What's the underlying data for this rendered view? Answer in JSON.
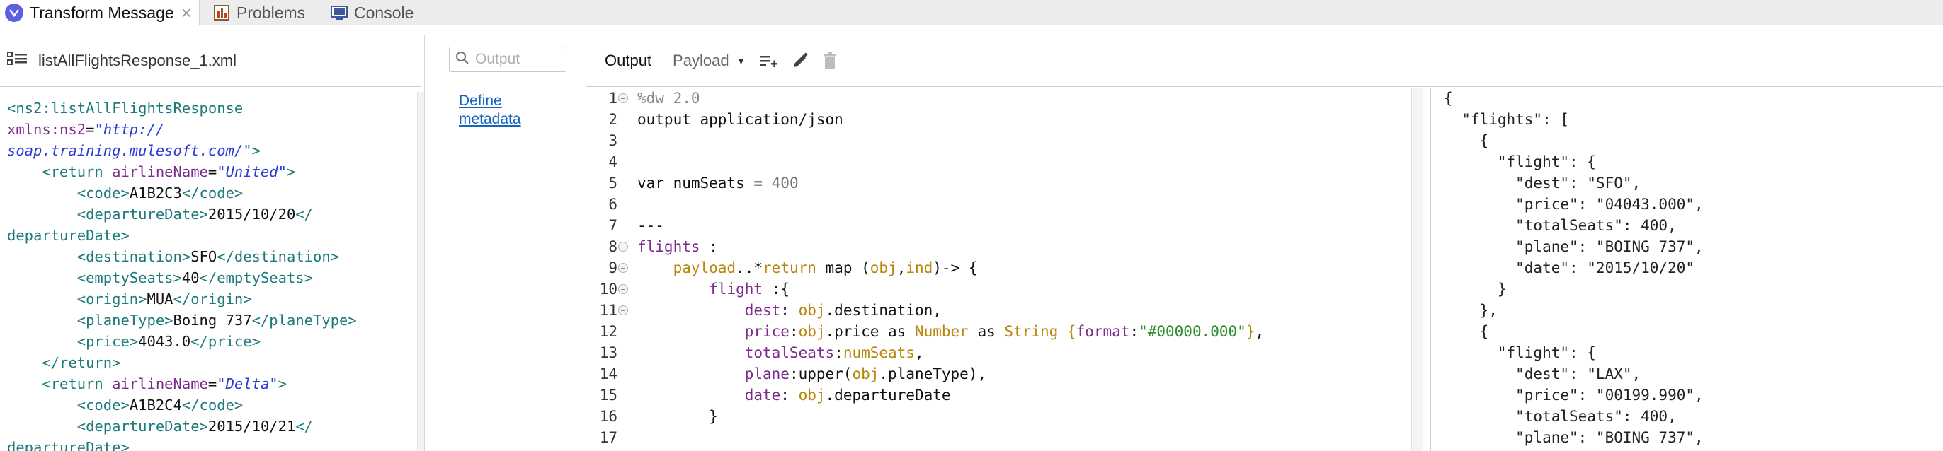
{
  "tabs": [
    {
      "label": "Transform Message",
      "icon": "transform-icon",
      "active": true
    },
    {
      "label": "Problems",
      "icon": "problems-icon",
      "active": false
    },
    {
      "label": "Console",
      "icon": "console-icon",
      "active": false
    }
  ],
  "input_panel": {
    "file_name": "listAllFlightsResponse_1.xml",
    "xml_lines": [
      [
        {
          "c": "t",
          "s": "<ns2:listAllFlightsResponse"
        }
      ],
      [
        {
          "c": "a",
          "s": "xmlns:ns2"
        },
        {
          "c": "tx",
          "s": "="
        },
        {
          "c": "v",
          "s": "\"http://"
        }
      ],
      [
        {
          "c": "v",
          "s": "soap.training.mulesoft.com/\""
        },
        {
          "c": "t",
          "s": ">"
        }
      ],
      [
        {
          "c": "tx",
          "s": "    "
        },
        {
          "c": "t",
          "s": "<return "
        },
        {
          "c": "a",
          "s": "airlineName"
        },
        {
          "c": "tx",
          "s": "="
        },
        {
          "c": "v",
          "s": "\"United\""
        },
        {
          "c": "t",
          "s": ">"
        }
      ],
      [
        {
          "c": "tx",
          "s": "        "
        },
        {
          "c": "t",
          "s": "<code>"
        },
        {
          "c": "tx",
          "s": "A1B2C3"
        },
        {
          "c": "t",
          "s": "</code>"
        }
      ],
      [
        {
          "c": "tx",
          "s": "        "
        },
        {
          "c": "t",
          "s": "<departureDate>"
        },
        {
          "c": "tx",
          "s": "2015/10/20"
        },
        {
          "c": "t",
          "s": "</"
        }
      ],
      [
        {
          "c": "t",
          "s": "departureDate>"
        }
      ],
      [
        {
          "c": "tx",
          "s": "        "
        },
        {
          "c": "t",
          "s": "<destination>"
        },
        {
          "c": "tx",
          "s": "SFO"
        },
        {
          "c": "t",
          "s": "</destination>"
        }
      ],
      [
        {
          "c": "tx",
          "s": "        "
        },
        {
          "c": "t",
          "s": "<emptySeats>"
        },
        {
          "c": "tx",
          "s": "40"
        },
        {
          "c": "t",
          "s": "</emptySeats>"
        }
      ],
      [
        {
          "c": "tx",
          "s": "        "
        },
        {
          "c": "t",
          "s": "<origin>"
        },
        {
          "c": "tx",
          "s": "MUA"
        },
        {
          "c": "t",
          "s": "</origin>"
        }
      ],
      [
        {
          "c": "tx",
          "s": "        "
        },
        {
          "c": "t",
          "s": "<planeType>"
        },
        {
          "c": "tx",
          "s": "Boing 737"
        },
        {
          "c": "t",
          "s": "</planeType>"
        }
      ],
      [
        {
          "c": "tx",
          "s": "        "
        },
        {
          "c": "t",
          "s": "<price>"
        },
        {
          "c": "tx",
          "s": "4043.0"
        },
        {
          "c": "t",
          "s": "</price>"
        }
      ],
      [
        {
          "c": "tx",
          "s": "    "
        },
        {
          "c": "t",
          "s": "</return>"
        }
      ],
      [
        {
          "c": "tx",
          "s": "    "
        },
        {
          "c": "t",
          "s": "<return "
        },
        {
          "c": "a",
          "s": "airlineName"
        },
        {
          "c": "tx",
          "s": "="
        },
        {
          "c": "v",
          "s": "\"Delta\""
        },
        {
          "c": "t",
          "s": ">"
        }
      ],
      [
        {
          "c": "tx",
          "s": "        "
        },
        {
          "c": "t",
          "s": "<code>"
        },
        {
          "c": "tx",
          "s": "A1B2C4"
        },
        {
          "c": "t",
          "s": "</code>"
        }
      ],
      [
        {
          "c": "tx",
          "s": "        "
        },
        {
          "c": "t",
          "s": "<departureDate>"
        },
        {
          "c": "tx",
          "s": "2015/10/21"
        },
        {
          "c": "t",
          "s": "</"
        }
      ],
      [
        {
          "c": "t",
          "s": "departureDate>"
        }
      ]
    ]
  },
  "metadata_panel": {
    "search_placeholder": "Output",
    "define_metadata_label": "Define metadata"
  },
  "editor": {
    "output_label": "Output",
    "target_select": "Payload",
    "icons": [
      "add-list-icon",
      "edit-icon",
      "delete-icon"
    ],
    "lines": [
      {
        "n": "1",
        "fold": true,
        "t": [
          {
            "c": "gr",
            "s": "%dw 2.0"
          }
        ]
      },
      {
        "n": "2",
        "fold": false,
        "t": [
          {
            "c": "op",
            "s": "output application/json"
          }
        ]
      },
      {
        "n": "3",
        "fold": false,
        "t": []
      },
      {
        "n": "4",
        "fold": false,
        "t": []
      },
      {
        "n": "5",
        "fold": false,
        "t": [
          {
            "c": "op",
            "s": "var numSeats = "
          },
          {
            "c": "num",
            "s": "400"
          }
        ]
      },
      {
        "n": "6",
        "fold": false,
        "t": []
      },
      {
        "n": "7",
        "fold": false,
        "t": [
          {
            "c": "op",
            "s": "---"
          }
        ]
      },
      {
        "n": "8",
        "fold": true,
        "t": [
          {
            "c": "kw",
            "s": "flights"
          },
          {
            "c": "op",
            "s": " :"
          }
        ]
      },
      {
        "n": "9",
        "fold": true,
        "t": [
          {
            "c": "op",
            "s": "    "
          },
          {
            "c": "fn",
            "s": "payload"
          },
          {
            "c": "op",
            "s": "..*"
          },
          {
            "c": "fn",
            "s": "return"
          },
          {
            "c": "op",
            "s": " map ("
          },
          {
            "c": "fn",
            "s": "obj"
          },
          {
            "c": "op",
            "s": ","
          },
          {
            "c": "fn",
            "s": "ind"
          },
          {
            "c": "op",
            "s": ")-> {"
          }
        ]
      },
      {
        "n": "10",
        "fold": true,
        "t": [
          {
            "c": "op",
            "s": "        "
          },
          {
            "c": "kw",
            "s": "flight"
          },
          {
            "c": "op",
            "s": " :{"
          }
        ]
      },
      {
        "n": "11",
        "fold": true,
        "t": [
          {
            "c": "op",
            "s": "            "
          },
          {
            "c": "kw",
            "s": "dest"
          },
          {
            "c": "op",
            "s": ": "
          },
          {
            "c": "fn",
            "s": "obj"
          },
          {
            "c": "op",
            "s": ".destination,"
          }
        ]
      },
      {
        "n": "12",
        "fold": false,
        "t": [
          {
            "c": "op",
            "s": "            "
          },
          {
            "c": "kw",
            "s": "price"
          },
          {
            "c": "op",
            "s": ":"
          },
          {
            "c": "fn",
            "s": "obj"
          },
          {
            "c": "op",
            "s": ".price as "
          },
          {
            "c": "fn",
            "s": "Number"
          },
          {
            "c": "op",
            "s": " as "
          },
          {
            "c": "fn",
            "s": "String"
          },
          {
            "c": "op",
            "s": " "
          },
          {
            "c": "fn",
            "s": "{"
          },
          {
            "c": "kw",
            "s": "format"
          },
          {
            "c": "op",
            "s": ":"
          },
          {
            "c": "str",
            "s": "\"#00000.000\""
          },
          {
            "c": "fn",
            "s": "}"
          },
          {
            "c": "op",
            "s": ","
          }
        ]
      },
      {
        "n": "13",
        "fold": false,
        "t": [
          {
            "c": "op",
            "s": "            "
          },
          {
            "c": "kw",
            "s": "totalSeats"
          },
          {
            "c": "op",
            "s": ":"
          },
          {
            "c": "fn",
            "s": "numSeats"
          },
          {
            "c": "op",
            "s": ","
          }
        ]
      },
      {
        "n": "14",
        "fold": false,
        "t": [
          {
            "c": "op",
            "s": "            "
          },
          {
            "c": "kw",
            "s": "plane"
          },
          {
            "c": "op",
            "s": ":upper("
          },
          {
            "c": "fn",
            "s": "obj"
          },
          {
            "c": "op",
            "s": ".planeType),"
          }
        ]
      },
      {
        "n": "15",
        "fold": false,
        "t": [
          {
            "c": "op",
            "s": "            "
          },
          {
            "c": "kw",
            "s": "date"
          },
          {
            "c": "op",
            "s": ": "
          },
          {
            "c": "fn",
            "s": "obj"
          },
          {
            "c": "op",
            "s": ".departureDate"
          }
        ]
      },
      {
        "n": "16",
        "fold": false,
        "t": [
          {
            "c": "op",
            "s": "        }"
          }
        ]
      },
      {
        "n": "17",
        "fold": false,
        "t": []
      }
    ]
  },
  "preview": {
    "json_lines": [
      "{",
      "  \"flights\": [",
      "    {",
      "      \"flight\": {",
      "        \"dest\": \"SFO\",",
      "        \"price\": \"04043.000\",",
      "        \"totalSeats\": 400,",
      "        \"plane\": \"BOING 737\",",
      "        \"date\": \"2015/10/20\"",
      "      }",
      "    },",
      "    {",
      "      \"flight\": {",
      "        \"dest\": \"LAX\",",
      "        \"price\": \"00199.990\",",
      "        \"totalSeats\": 400,",
      "        \"plane\": \"BOING 737\","
    ]
  },
  "colors": {
    "xml_tag": "#1d7a7a",
    "xml_attr": "#7a2d8a",
    "xml_value": "#2b3bd8",
    "keyword": "#7a2d8a",
    "identifier": "#b8860b",
    "string": "#2e8b2e",
    "link": "#1565c0"
  }
}
